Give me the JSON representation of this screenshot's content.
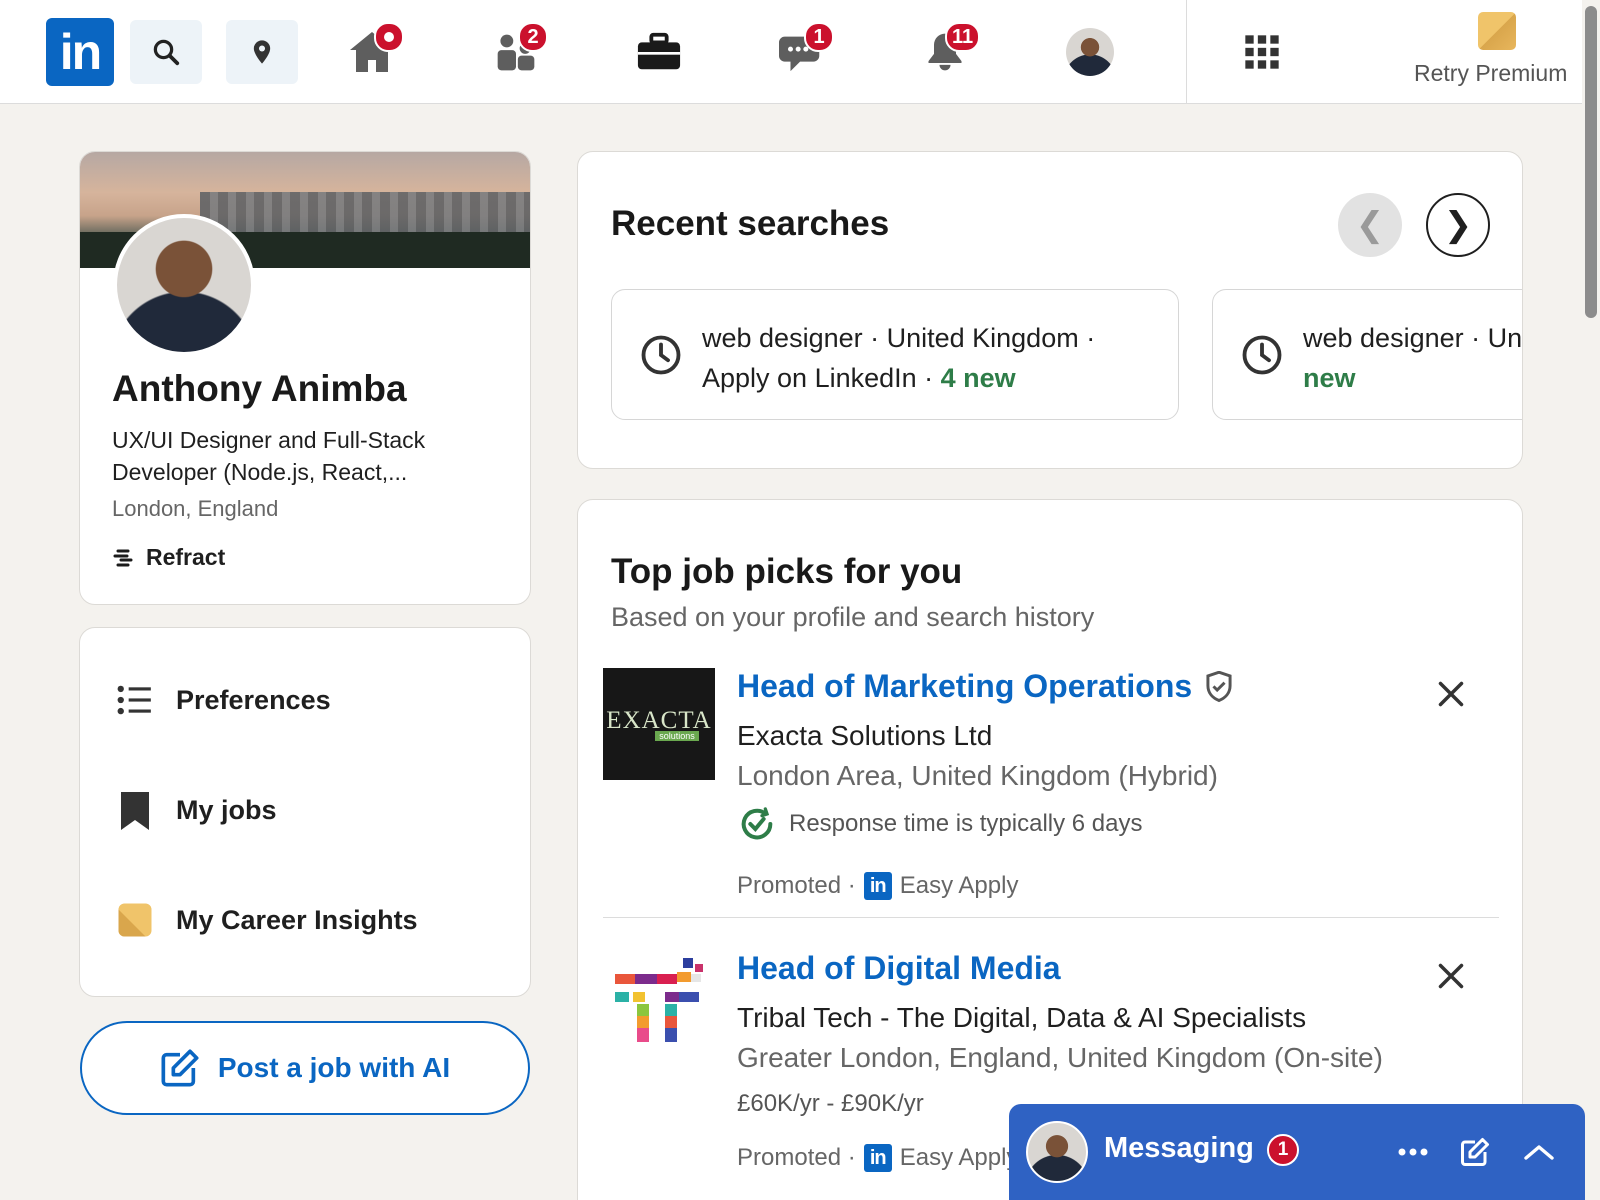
{
  "nav": {
    "logo": "in",
    "badges": {
      "home": "",
      "network": "2",
      "messaging": "1",
      "notifications": "11"
    },
    "premium_label": "Retry Premium"
  },
  "profile": {
    "name": "Anthony Animba",
    "headline": "UX/UI Designer and Full-Stack Developer (Node.js, React,...",
    "location": "London, England",
    "company": "Refract"
  },
  "menu": {
    "items": [
      {
        "label": "Preferences",
        "icon": "list-icon"
      },
      {
        "label": "My jobs",
        "icon": "bookmark-icon"
      },
      {
        "label": "My Career Insights",
        "icon": "premium-insights-icon"
      }
    ],
    "post_job_label": "Post a job with AI"
  },
  "recent_searches": {
    "title": "Recent searches",
    "items": [
      {
        "query": "web designer · United Kingdom · Apply on LinkedIn · ",
        "new_label": "4 new"
      },
      {
        "query": "web designer · United Kingdom · ",
        "new_label": "new"
      }
    ]
  },
  "jobs": {
    "title": "Top job picks for you",
    "subtitle": "Based on your profile and search history",
    "items": [
      {
        "title": "Head of Marketing Operations",
        "company": "Exacta Solutions Ltd",
        "location": "London Area, United Kingdom (Hybrid)",
        "response": "Response time is typically 6 days",
        "promoted": "Promoted ·",
        "apply": "Easy Apply",
        "logo_text": "EXACTA",
        "logo_sub": "solutions"
      },
      {
        "title": "Head of Digital Media",
        "company": "Tribal Tech - The Digital, Data & AI Specialists",
        "location": "Greater London, England, United Kingdom (On-site)",
        "salary": "£60K/yr - £90K/yr",
        "promoted": "Promoted ·",
        "apply": "Easy Apply"
      }
    ]
  },
  "messaging": {
    "label": "Messaging",
    "badge": "1"
  },
  "colors": {
    "brand": "#0a66c2",
    "badge": "#cb112d",
    "new_green": "#2e7d48",
    "background": "#f4f2ee"
  }
}
